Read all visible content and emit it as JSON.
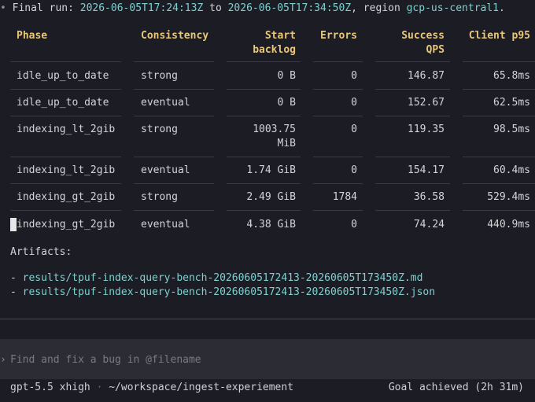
{
  "summary": {
    "bullet": "•",
    "prefix": "Final run: ",
    "start": "2026-06-05T17:24:13Z",
    "to": " to ",
    "end": "2026-06-05T17:34:50Z",
    "region_prefix": ", region ",
    "region": "gcp-us-central1",
    "suffix": "."
  },
  "table": {
    "headers": {
      "phase": "Phase",
      "consistency": "Consistency",
      "start_backlog_1": "Start",
      "start_backlog_2": "backlog",
      "errors": "Errors",
      "success_qps_1": "Success",
      "success_qps_2": "QPS",
      "client_p95": "Client p95"
    },
    "rows": [
      {
        "phase": "idle_up_to_date",
        "consistency": "strong",
        "backlog": "0 B",
        "backlog2": "",
        "errors": "0",
        "qps": "146.87",
        "p95": "65.8ms"
      },
      {
        "phase": "idle_up_to_date",
        "consistency": "eventual",
        "backlog": "0 B",
        "backlog2": "",
        "errors": "0",
        "qps": "152.67",
        "p95": "62.5ms"
      },
      {
        "phase": "indexing_lt_2gib",
        "consistency": "strong",
        "backlog": "1003.75",
        "backlog2": "MiB",
        "errors": "0",
        "qps": "119.35",
        "p95": "98.5ms"
      },
      {
        "phase": "indexing_lt_2gib",
        "consistency": "eventual",
        "backlog": "1.74 GiB",
        "backlog2": "",
        "errors": "0",
        "qps": "154.17",
        "p95": "60.4ms"
      },
      {
        "phase": "indexing_gt_2gib",
        "consistency": "strong",
        "backlog": "2.49 GiB",
        "backlog2": "",
        "errors": "1784",
        "qps": "36.58",
        "p95": "529.4ms"
      },
      {
        "phase": "indexing_gt_2gib",
        "consistency": "eventual",
        "backlog": "4.38 GiB",
        "backlog2": "",
        "errors": "0",
        "qps": "74.24",
        "p95": "440.9ms"
      }
    ]
  },
  "artifacts": {
    "label": "Artifacts:",
    "items": [
      {
        "dash": "- ",
        "path": "results/tpuf-index-query-bench-20260605172413-20260605T173450Z.md"
      },
      {
        "dash": "- ",
        "path": "results/tpuf-index-query-bench-20260605172413-20260605T173450Z.json"
      }
    ]
  },
  "prompt": {
    "chevron": "›",
    "placeholder": "Find and fix a bug in @filename"
  },
  "status": {
    "model": "gpt-5.5 xhigh",
    "dot": " · ",
    "path": "~/workspace/ingest-experiement",
    "goal": "Goal achieved (2h 31m)"
  },
  "colors": {
    "background": "#1c1c24",
    "accent_teal": "#7fd0cf",
    "header_gold": "#e8c77a",
    "input_bar": "#2c2c35"
  }
}
